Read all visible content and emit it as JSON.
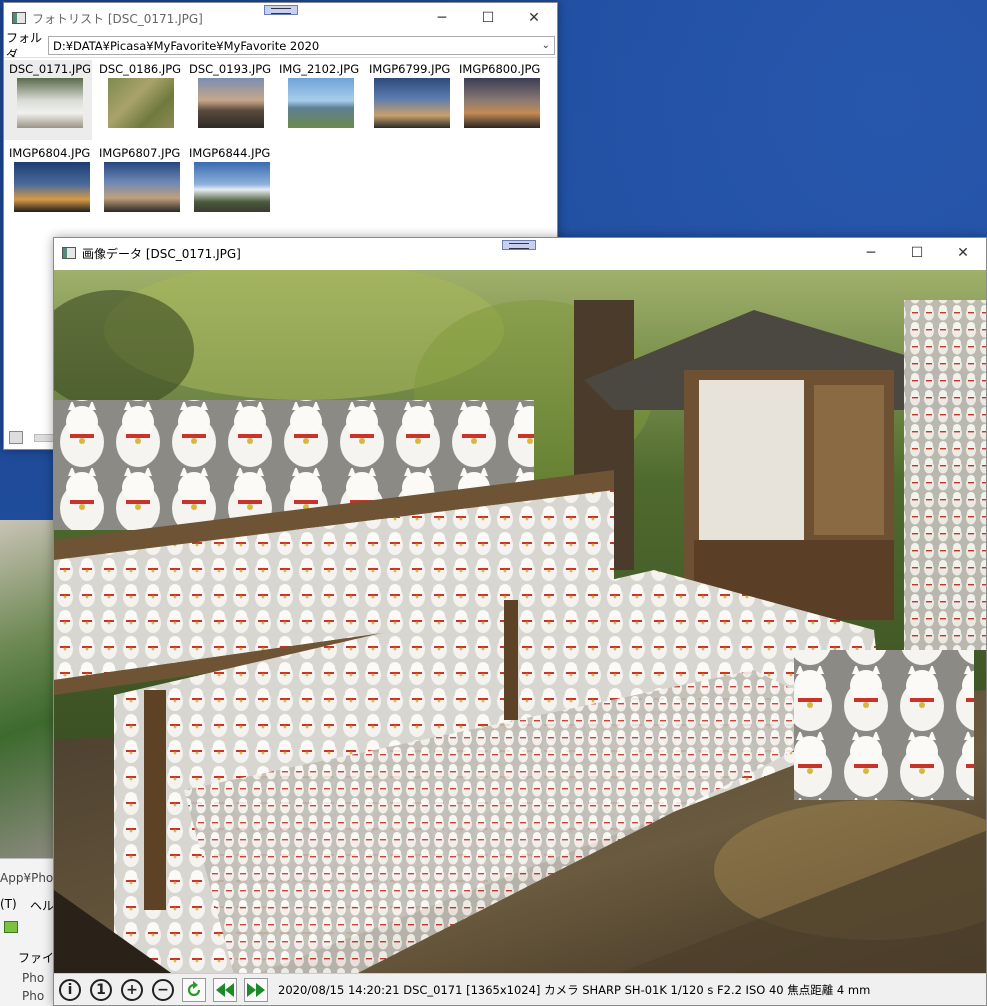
{
  "list_window": {
    "title": "フォトリスト [DSC_0171.JPG]",
    "folder_label": "フォルダ",
    "folder_path": "D:¥DATA¥Picasa¥MyFavorite¥MyFavorite 2020",
    "thumbnails": [
      {
        "name": "DSC_0171.JPG",
        "selected": true
      },
      {
        "name": "DSC_0186.JPG"
      },
      {
        "name": "DSC_0193.JPG"
      },
      {
        "name": "IMG_2102.JPG"
      },
      {
        "name": "IMGP6799.JPG"
      },
      {
        "name": "IMGP6800.JPG"
      },
      {
        "name": "IMGP6804.JPG"
      },
      {
        "name": "IMGP6807.JPG"
      },
      {
        "name": "IMGP6844.JPG"
      }
    ]
  },
  "image_window": {
    "title": "画像データ [DSC_0171.JPG]",
    "status": "2020/08/15 14:20:21 DSC_0171 [1365x1024] カメラ SHARP SH-01K  1/120 s F2.2 ISO 40 焦点距離 4 mm",
    "toolbar": {
      "info_label": "i",
      "one_label": "1",
      "zoom_in_label": "+",
      "zoom_out_label": "−"
    }
  },
  "background_app": {
    "path_fragment": "App¥Photo",
    "menu_t": "(T)",
    "menu_help": "ヘル",
    "panel_label": "ファイル",
    "item1": "Pho",
    "item2": "Pho"
  },
  "caption_buttons": {
    "minimize": "─",
    "maximize": "☐",
    "close": "✕"
  }
}
